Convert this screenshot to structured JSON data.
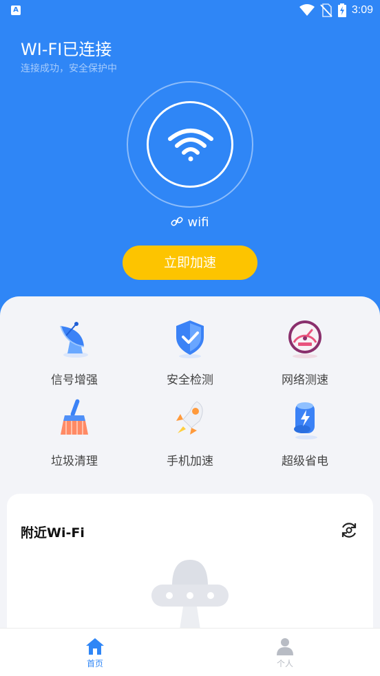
{
  "status_bar": {
    "app_badge": "A",
    "time": "3:09"
  },
  "header": {
    "title": "WI-FI已连接",
    "subtitle": "连接成功，安全保护中"
  },
  "network": {
    "ssid": "wifi"
  },
  "boost_button": {
    "label": "立即加速"
  },
  "features": [
    {
      "label": "信号增强",
      "icon": "satellite-dish-icon"
    },
    {
      "label": "安全检测",
      "icon": "shield-check-icon"
    },
    {
      "label": "网络测速",
      "icon": "speedometer-icon"
    },
    {
      "label": "垃圾清理",
      "icon": "broom-icon"
    },
    {
      "label": "手机加速",
      "icon": "rocket-icon"
    },
    {
      "label": "超级省电",
      "icon": "battery-lightning-icon"
    }
  ],
  "nearby": {
    "title": "附近Wi-Fi"
  },
  "tabs": [
    {
      "label": "首页",
      "active": true
    },
    {
      "label": "个人",
      "active": false
    }
  ],
  "colors": {
    "primary": "#2f86f6",
    "accent": "#fdc400",
    "inactive": "#b8bcc4"
  }
}
